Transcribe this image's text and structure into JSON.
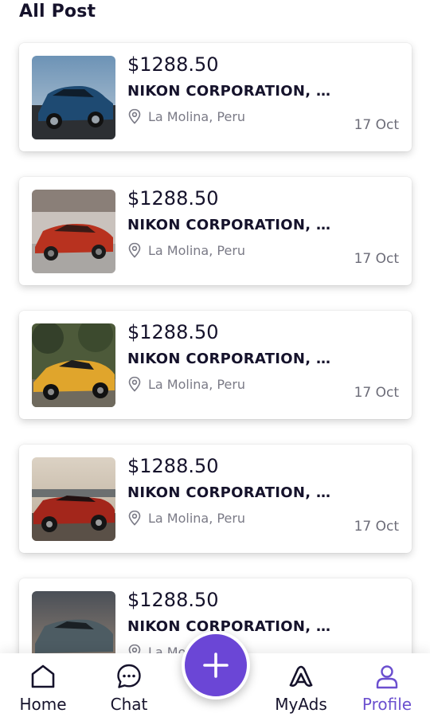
{
  "page": {
    "title": "All Post"
  },
  "colors": {
    "accent": "#6b46d6",
    "text": "#15122b",
    "muted": "#7a7a86",
    "active_nav": "#6b4fcf"
  },
  "posts": [
    {
      "price": "$1288.50",
      "company": "NIKON CORPORATION, N...",
      "location": "La Molina, Peru",
      "date": "17 Oct",
      "image": "blue-sedan"
    },
    {
      "price": "$1288.50",
      "company": "NIKON CORPORATION, N...",
      "location": "La Molina, Peru",
      "date": "17 Oct",
      "image": "red-sports-car"
    },
    {
      "price": "$1288.50",
      "company": "NIKON CORPORATION, N...",
      "location": "La Molina, Peru",
      "date": "17 Oct",
      "image": "yellow-supercar"
    },
    {
      "price": "$1288.50",
      "company": "NIKON CORPORATION, N...",
      "location": "La Molina, Peru",
      "date": "17 Oct",
      "image": "red-classic-muscle-car"
    },
    {
      "price": "$1288.50",
      "company": "NIKON CORPORATION, N...",
      "location": "La Molina, Peru",
      "date": "",
      "image": "grey-sports-sedan"
    }
  ],
  "nav": {
    "items": [
      {
        "label": "Home",
        "icon": "home-icon"
      },
      {
        "label": "Chat",
        "icon": "chat-icon"
      },
      {
        "label": "MyAds",
        "icon": "ads-icon"
      },
      {
        "label": "Profile",
        "icon": "profile-icon",
        "active": true
      }
    ],
    "fab_icon": "plus-icon"
  }
}
